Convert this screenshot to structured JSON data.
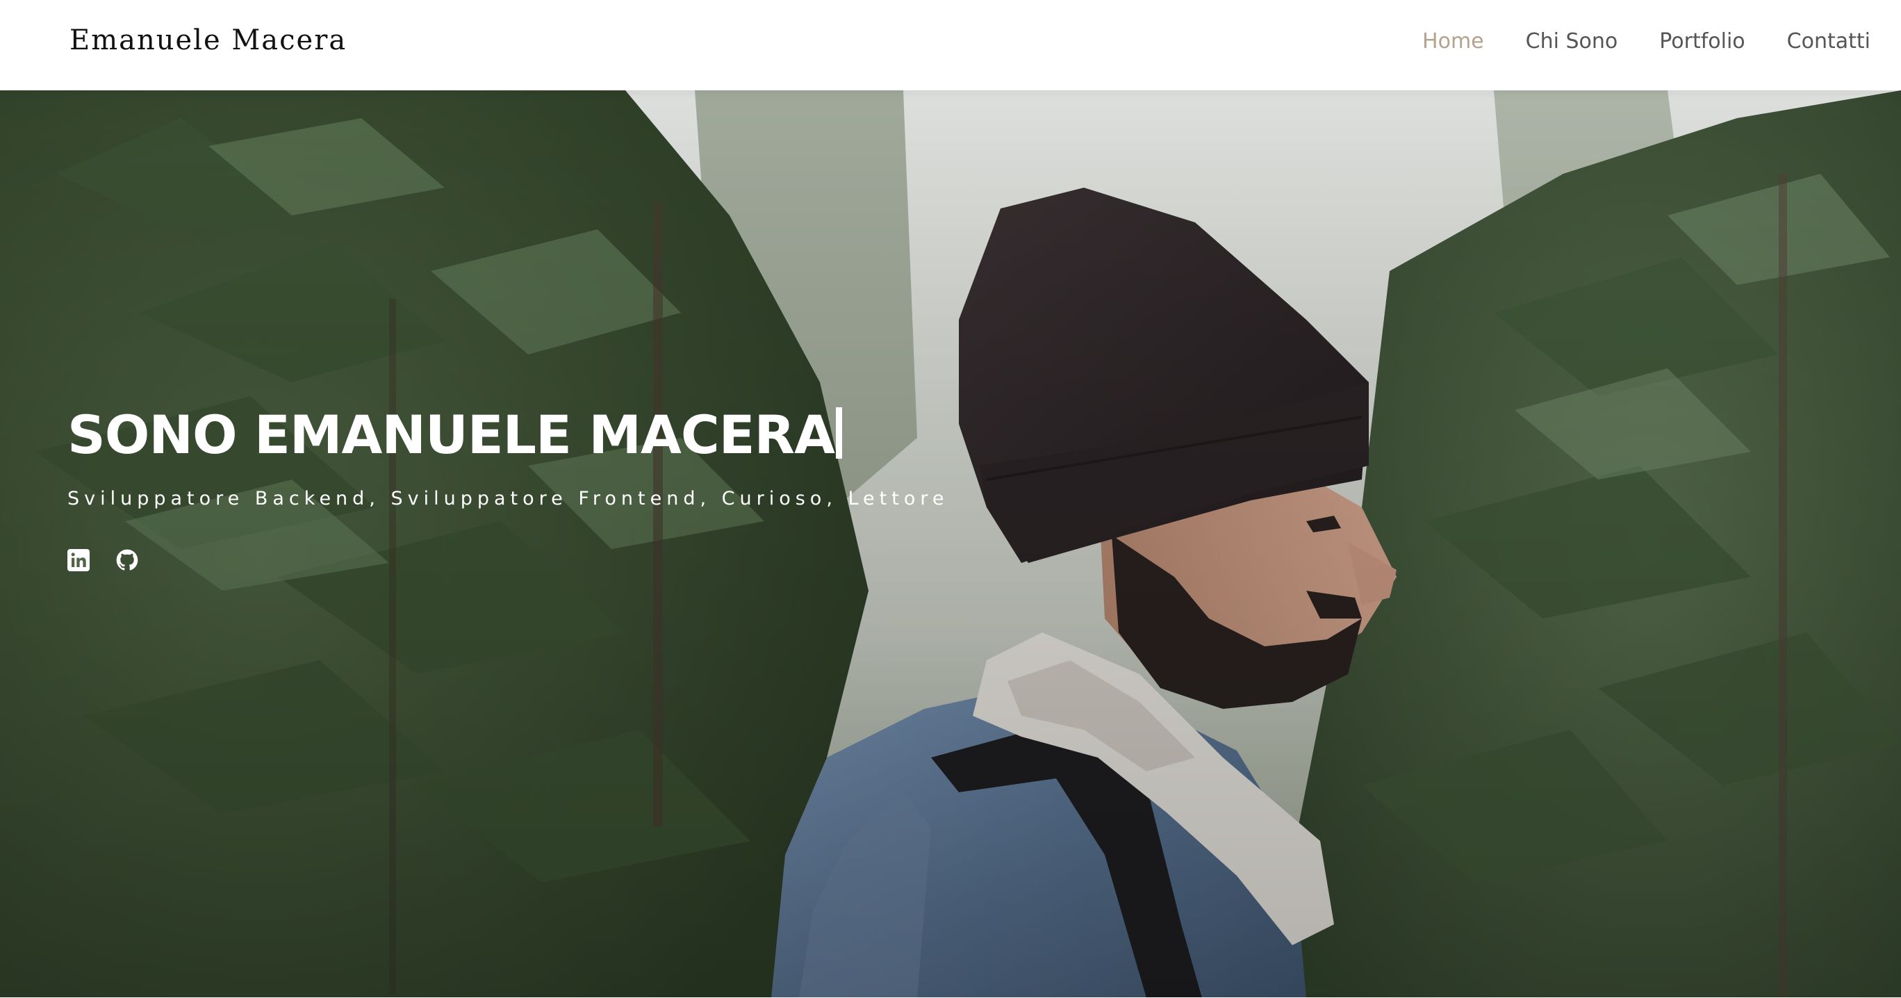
{
  "header": {
    "logo": "Emanuele Macera",
    "nav": [
      {
        "label": "Home",
        "active": true
      },
      {
        "label": "Chi Sono",
        "active": false
      },
      {
        "label": "Portfolio",
        "active": false
      },
      {
        "label": "Contatti",
        "active": false
      }
    ]
  },
  "hero": {
    "title": "SONO EMANUELE MACERA",
    "subtitle": "Sviluppatore Backend, Sviluppatore Frontend, Curioso, Lettore",
    "socials": [
      {
        "icon": "linkedin-icon"
      },
      {
        "icon": "github-icon"
      }
    ]
  },
  "colors": {
    "nav_active": "#b3a38b",
    "nav_default": "#555555",
    "hero_text": "#ffffff"
  }
}
